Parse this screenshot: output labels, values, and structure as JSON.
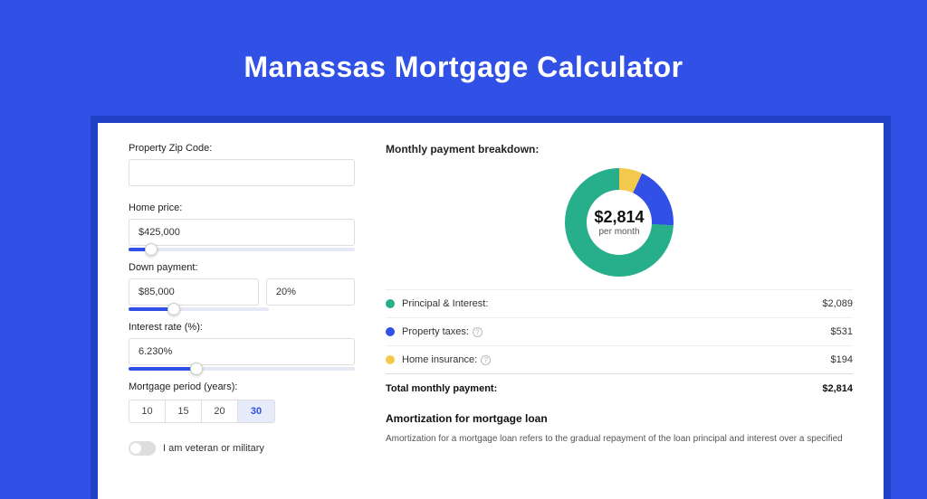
{
  "title": "Manassas Mortgage Calculator",
  "form": {
    "zip_label": "Property Zip Code:",
    "zip_value": "",
    "home_price_label": "Home price:",
    "home_price_value": "$425,000",
    "down_payment_label": "Down payment:",
    "down_payment_value": "$85,000",
    "down_payment_pct": "20%",
    "interest_label": "Interest rate (%):",
    "interest_value": "6.230%",
    "period_label": "Mortgage period (years):",
    "periods": [
      "10",
      "15",
      "20",
      "30"
    ],
    "period_selected": "30",
    "veteran_label": "I am veteran or military"
  },
  "breakdown": {
    "section_title": "Monthly payment breakdown:",
    "center_amount": "$2,814",
    "center_sub": "per month",
    "items": [
      {
        "label": "Principal & Interest:",
        "value": "$2,089",
        "color": "g"
      },
      {
        "label": "Property taxes:",
        "value": "$531",
        "color": "b",
        "info": true
      },
      {
        "label": "Home insurance:",
        "value": "$194",
        "color": "y",
        "info": true
      }
    ],
    "total_label": "Total monthly payment:",
    "total_value": "$2,814"
  },
  "amort": {
    "title": "Amortization for mortgage loan",
    "text": "Amortization for a mortgage loan refers to the gradual repayment of the loan principal and interest over a specified"
  },
  "chart_data": {
    "type": "pie",
    "title": "Monthly payment breakdown",
    "series": [
      {
        "name": "Principal & Interest",
        "value": 2089,
        "color": "#27ae8a"
      },
      {
        "name": "Property taxes",
        "value": 531,
        "color": "#3050e6"
      },
      {
        "name": "Home insurance",
        "value": 194,
        "color": "#f2c94c"
      }
    ],
    "total": 2814,
    "center_label": "$2,814 per month"
  }
}
